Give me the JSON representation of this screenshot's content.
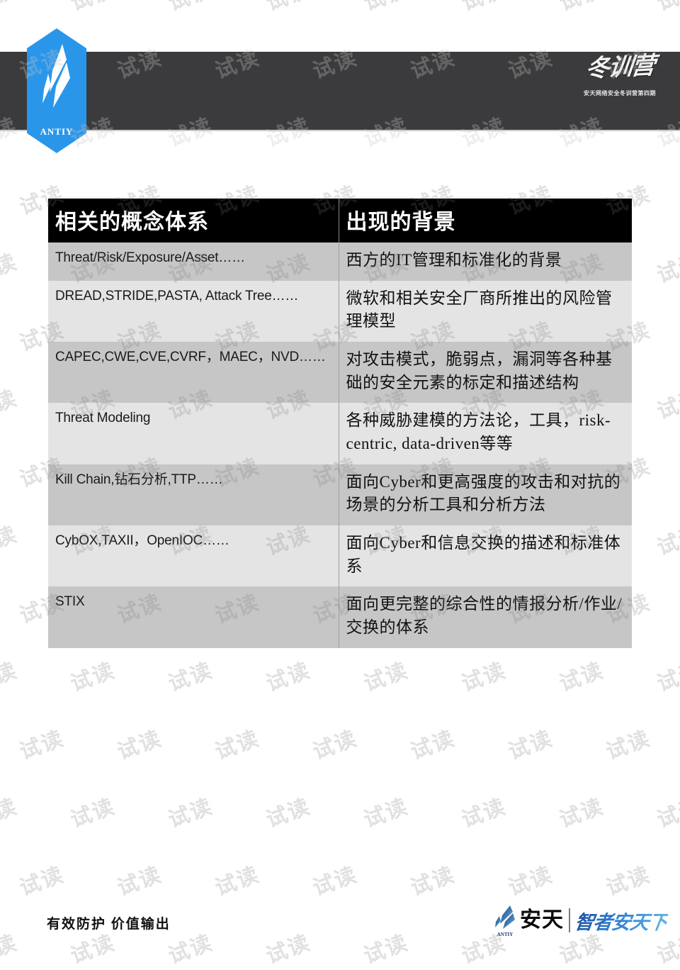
{
  "header": {
    "logo_brand": "ANTIY",
    "logo_icon": "antiy-feather-icon",
    "calligraphy_title": "冬训营",
    "calligraphy_subtitle": "安天网络安全冬训营第四期"
  },
  "watermark": {
    "text": "试读"
  },
  "table": {
    "columns": [
      "相关的概念体系",
      "出现的背景"
    ],
    "rows": [
      {
        "concept": "Threat/Risk/Exposure/Asset……",
        "background": "西方的IT管理和标准化的背景"
      },
      {
        "concept": "DREAD,STRIDE,PASTA, Attack Tree……",
        "background": "微软和相关安全厂商所推出的风险管理模型"
      },
      {
        "concept": "CAPEC,CWE,CVE,CVRF，MAEC，NVD……",
        "background": "对攻击模式，脆弱点，漏洞等各种基础的安全元素的标定和描述结构"
      },
      {
        "concept": "Threat Modeling",
        "background": "各种威胁建模的方法论，工具，risk-centric, data-driven等等"
      },
      {
        "concept": "Kill Chain,钻石分析,TTP……",
        "background": "面向Cyber和更高强度的攻击和对抗的场景的分析工具和分析方法"
      },
      {
        "concept": "CybOX,TAXII，OpenIOC……",
        "background": "面向Cyber和信息交换的描述和标准体系"
      },
      {
        "concept": "STIX",
        "background": "面向更完整的综合性的情报分析/作业/交换的体系"
      }
    ]
  },
  "footer": {
    "slogan": "有效防护 价值输出",
    "logo_mark": "antiy-feather-icon",
    "logo_small_brand": "ANTIY",
    "logo_name": "安天",
    "logo_tagline": "智者安天下"
  },
  "colors": {
    "brand_blue": "#2a96ea",
    "header_band": "#3b3b3d",
    "table_header_bg": "#000000",
    "row_dark": "#c6c6c6",
    "row_light": "#e4e4e4"
  }
}
